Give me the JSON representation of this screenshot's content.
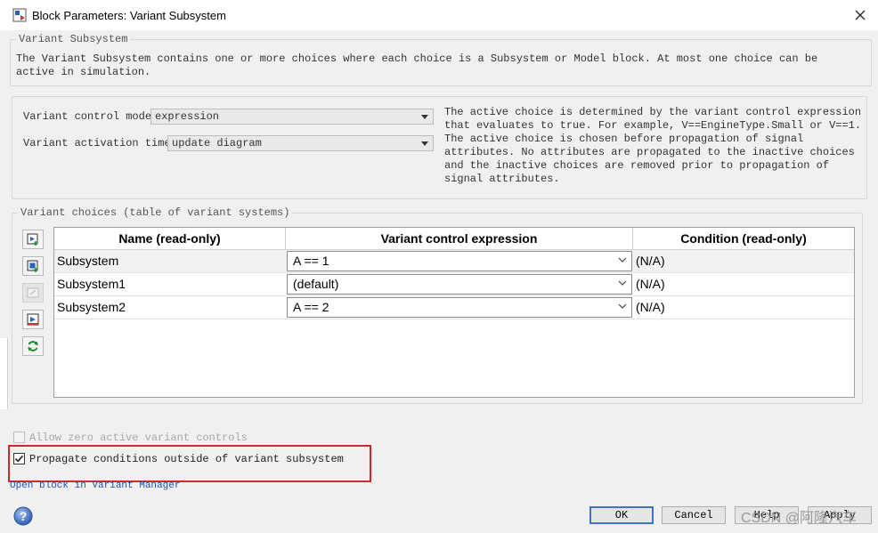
{
  "window": {
    "title": "Block Parameters: Variant Subsystem"
  },
  "description": {
    "legend": "Variant Subsystem",
    "text": "The Variant Subsystem contains one or more choices where each choice is a Subsystem or Model block. At most one choice can be active in simulation."
  },
  "settings": {
    "control_mode_label": "Variant control mode:",
    "control_mode_value": "expression",
    "activation_time_label": "Variant activation time:",
    "activation_time_value": "update diagram",
    "help_text": "The active choice is determined by the variant control expression that evaluates to true. For example, V==EngineType.Small or V==1. The active choice is chosen before propagation of signal attributes. No attributes are propagated to the inactive choices and the inactive choices are removed prior to propagation of signal attributes."
  },
  "choices": {
    "legend": "Variant choices (table of variant systems)",
    "columns": [
      "Name (read-only)",
      "Variant control expression",
      "Condition (read-only)"
    ],
    "rows": [
      {
        "name": "Subsystem",
        "expression": "A == 1",
        "condition": "(N/A)"
      },
      {
        "name": "Subsystem1",
        "expression": "(default)",
        "condition": "(N/A)"
      },
      {
        "name": "Subsystem2",
        "expression": "A == 2",
        "condition": "(N/A)"
      }
    ]
  },
  "options": {
    "allow_zero_label": "Allow zero active variant controls",
    "allow_zero_checked": false,
    "propagate_label": "Propagate conditions outside of variant subsystem",
    "propagate_checked": true,
    "open_manager_link": "Open block in Variant Manager"
  },
  "buttons": {
    "ok": "OK",
    "cancel": "Cancel",
    "help": "Help",
    "apply": "Apply"
  },
  "watermark": "CSDN @阿隆汽车"
}
